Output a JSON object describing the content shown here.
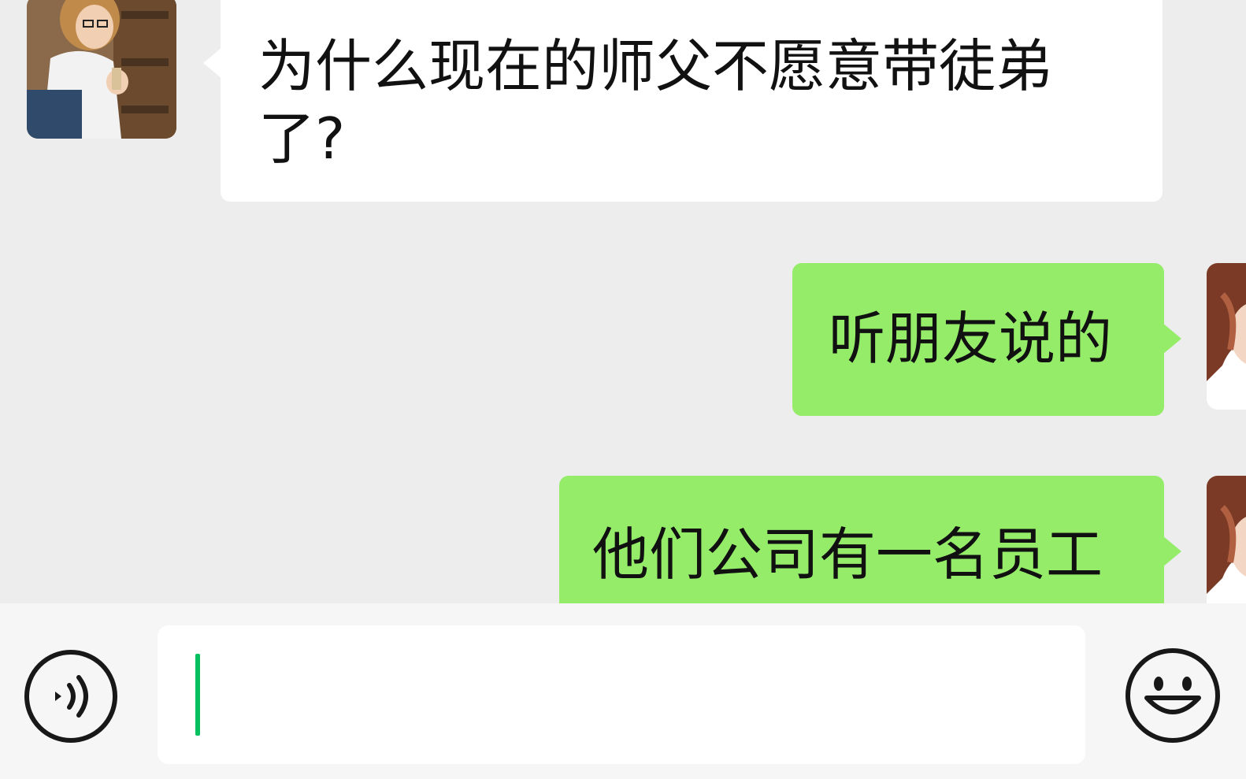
{
  "messages": [
    {
      "side": "incoming",
      "text": "为什么现在的师父不愿意带徒弟了?"
    },
    {
      "side": "outgoing",
      "text": "听朋友说的"
    },
    {
      "side": "outgoing",
      "text": "他们公司有一名员工"
    }
  ],
  "input": {
    "value": "",
    "placeholder": ""
  },
  "icons": {
    "voice": "voice-icon",
    "emoji": "emoji-icon"
  },
  "colors": {
    "background": "#ededed",
    "incoming_bubble": "#ffffff",
    "outgoing_bubble": "#95ec69",
    "caret": "#07c160"
  }
}
